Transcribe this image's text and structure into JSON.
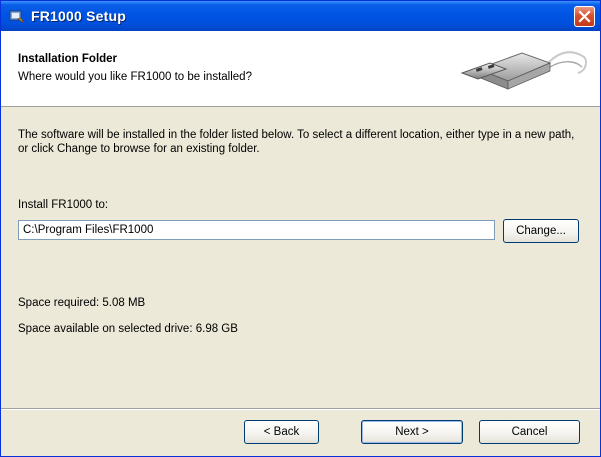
{
  "window": {
    "title": "FR1000 Setup"
  },
  "header": {
    "title": "Installation Folder",
    "subtitle": "Where would you like FR1000 to be installed?"
  },
  "body": {
    "description": "The software will be installed in the folder listed below. To select a different location, either type in a new path, or click Change to browse for an existing folder.",
    "install_label": "Install FR1000 to:",
    "install_path": "C:\\Program Files\\FR1000",
    "change_label": "Change...",
    "space_required": "Space required: 5.08 MB",
    "space_available": "Space available on selected drive: 6.98 GB"
  },
  "buttons": {
    "back": "< Back",
    "next": "Next >",
    "cancel": "Cancel"
  },
  "icons": {
    "app": "setup-app-icon",
    "close": "close-icon",
    "graphic": "usb-cable-graphic"
  }
}
